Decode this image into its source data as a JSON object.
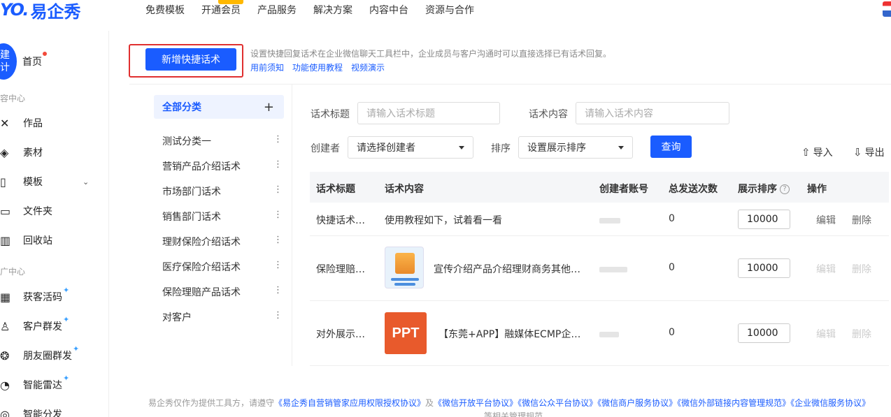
{
  "topbar": {
    "logo_text": "易企秀",
    "nav": [
      "免费模板",
      "开通会员",
      "产品服务",
      "解决方案",
      "内容中台",
      "资源与合作"
    ]
  },
  "sidebar": {
    "create_label_line1": "建",
    "create_label_line2": "计",
    "home": "首页",
    "section1": "容中心",
    "items1": [
      {
        "label": "作品",
        "icon": "works-icon"
      },
      {
        "label": "素材",
        "icon": "layers-icon"
      },
      {
        "label": "模板",
        "icon": "template-icon"
      },
      {
        "label": "文件夹",
        "icon": "folder-icon"
      },
      {
        "label": "回收站",
        "icon": "trash-icon"
      }
    ],
    "section2": "广中心",
    "items2": [
      {
        "label": "获客活码",
        "icon": "qrcode-icon"
      },
      {
        "label": "客户群发",
        "icon": "user-group-icon"
      },
      {
        "label": "朋友圈群发",
        "icon": "moments-icon"
      },
      {
        "label": "智能雷达",
        "icon": "radar-icon"
      },
      {
        "label": "智能分发",
        "icon": "distribute-icon"
      }
    ]
  },
  "main": {
    "create_button": "新增快捷话术",
    "description": "设置快捷回复话术在企业微信聊天工具栏中，企业成员与客户沟通时可以直接选择已有话术回复。",
    "links": [
      "用前须知",
      "功能使用教程",
      "视频演示"
    ]
  },
  "categories": {
    "all": "全部分类",
    "add": "+",
    "items": [
      "测试分类一",
      "营销产品介绍话术",
      "市场部门话术",
      "销售部门话术",
      "理财保险介绍话术",
      "医疗保险介绍话术",
      "保险理赔产品话术",
      "对客户"
    ]
  },
  "filters": {
    "title_label": "话术标题",
    "title_placeholder": "请输入话术标题",
    "content_label": "话术内容",
    "content_placeholder": "请输入话术内容",
    "creator_label": "创建者",
    "creator_value": "请选择创建者",
    "sort_label": "排序",
    "sort_value": "设置展示排序",
    "query": "查询",
    "import": "导入",
    "export": "导出"
  },
  "table": {
    "headers": [
      "话术标题",
      "话术内容",
      "创建者账号",
      "总发送次数",
      "展示排序",
      "操作"
    ],
    "rows": [
      {
        "title": "快捷话术…",
        "content": "使用教程如下，试着看一看",
        "creator": "",
        "count": "0",
        "sort": "10000",
        "edit": "编辑",
        "delete": "删除"
      },
      {
        "title": "保险理赔…",
        "content": "宣传介绍产品介绍理财商务其他…",
        "creator": "",
        "count": "0",
        "sort": "10000",
        "edit": "编辑",
        "delete": "删除"
      },
      {
        "title": "对外展示…",
        "content": "【东莞+APP】融媒体ECMP企…",
        "creator": "",
        "count": "0",
        "sort": "10000",
        "edit": "编辑",
        "delete": "删除",
        "thumb_text": "PPT"
      }
    ]
  },
  "footer": {
    "prefix": "易企秀仅作为提供工具方，请遵守",
    "link1": "《易企秀自营销管家应用权限授权协议》",
    "and": "及",
    "link2": "《微信开放平台协议》",
    "link3": "《微信公众平台协议》",
    "link4": "《微信商户服务协议》",
    "link5": "《微信外部链接内容管理规范》",
    "link6": "《企业微信服务协议》",
    "line2": "等相关管理规范"
  }
}
